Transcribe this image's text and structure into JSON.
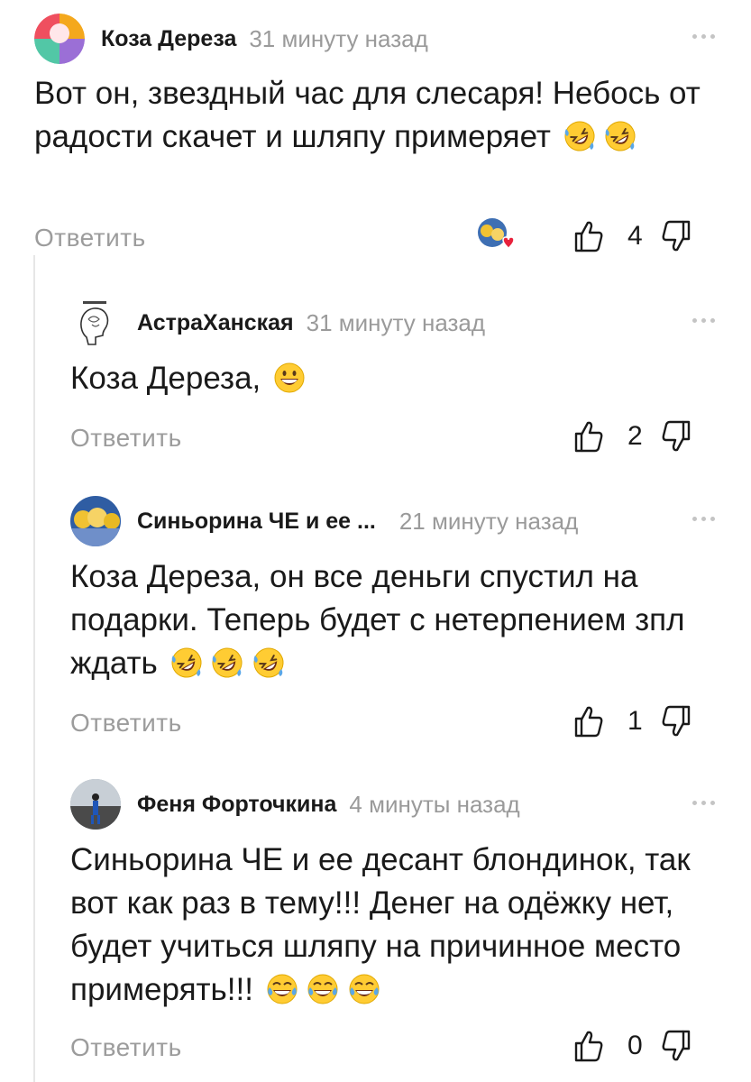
{
  "colors": {
    "accent_red": "#e8223c",
    "meta_gray": "#9a9a9a",
    "text": "#1a1a1a"
  },
  "comments": [
    {
      "author": "Коза Дереза",
      "time": "31 минуту назад",
      "text": "Вот он, звездный час для слесаря! Небось от радости скачет и шляпу примеряет",
      "emojis": [
        "rolling-laughing",
        "rolling-laughing"
      ],
      "reply_label": "Ответить",
      "likes": "4",
      "avatar_icon": "pinwheel-avatar-icon"
    },
    {
      "author": "АстраХанская",
      "time": "31 минуту назад",
      "text": "Коза Дереза,",
      "emojis": [
        "grinning"
      ],
      "reply_label": "Ответить",
      "likes": "2",
      "avatar_icon": "head-sketch-avatar-icon"
    },
    {
      "author": "Синьорина ЧЕ и ее ...",
      "time": "21 минуту назад",
      "text": "Коза Дереза, он все деньги спустил на подарки. Теперь будет с нетерпением зпл ждать",
      "emojis": [
        "rolling-laughing",
        "rolling-laughing",
        "rolling-laughing"
      ],
      "reply_label": "Ответить",
      "likes": "1",
      "avatar_icon": "blondes-avatar-icon"
    },
    {
      "author": "Феня Форточкина",
      "time": "4 минуты назад",
      "text": "Синьорина ЧЕ и ее десант блондинок, так вот как раз в тему!!! Денег на одёжку нет, будет учиться шляпу на причинное место примерять!!!",
      "emojis": [
        "tears-of-joy",
        "tears-of-joy",
        "tears-of-joy"
      ],
      "reply_label": "Ответить",
      "likes": "0",
      "avatar_icon": "person-photo-avatar-icon"
    }
  ]
}
